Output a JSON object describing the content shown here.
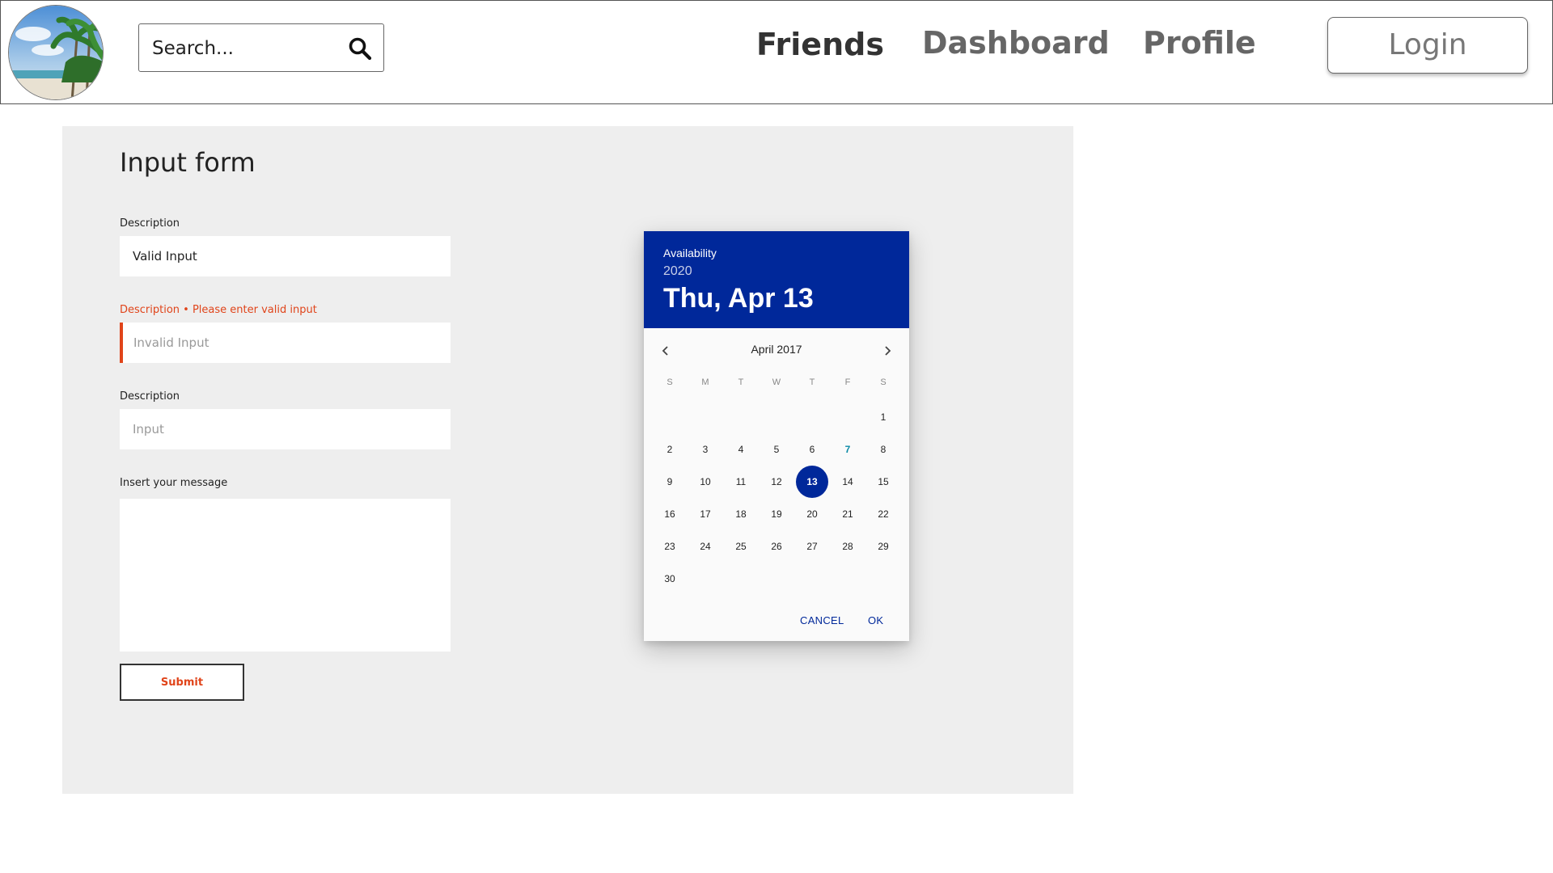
{
  "header": {
    "logo": "beach-palm-logo",
    "search": {
      "placeholder": "Search...",
      "icon": "search-icon"
    },
    "nav": [
      {
        "label": "Friends",
        "active": true
      },
      {
        "label": "Dashboard",
        "active": false
      },
      {
        "label": "Profile",
        "active": false
      }
    ],
    "login_label": "Login"
  },
  "form": {
    "title": "Input form",
    "fields": [
      {
        "label": "Description",
        "value": "Valid Input",
        "placeholder": "",
        "state": "valid"
      },
      {
        "label": "Description • Please enter valid input",
        "value": "",
        "placeholder": "Invalid Input",
        "state": "error"
      },
      {
        "label": "Description",
        "value": "",
        "placeholder": "Input",
        "state": "normal"
      }
    ],
    "message_label": "Insert your message",
    "message_value": "",
    "submit_label": "Submit",
    "colors": {
      "panel": "#eeeeee",
      "error": "#e0441a"
    }
  },
  "datepicker": {
    "label": "Availability",
    "year": "2020",
    "selected_text": "Thu, Apr 13",
    "month_label": "April 2017",
    "weekdays": [
      "S",
      "M",
      "T",
      "W",
      "T",
      "F",
      "S"
    ],
    "first_weekday": 6,
    "days_in_month": 30,
    "today": 7,
    "selected_day": 13,
    "cancel_label": "CANCEL",
    "ok_label": "OK",
    "colors": {
      "header": "#00289a",
      "today": "#0b8aa6"
    }
  }
}
